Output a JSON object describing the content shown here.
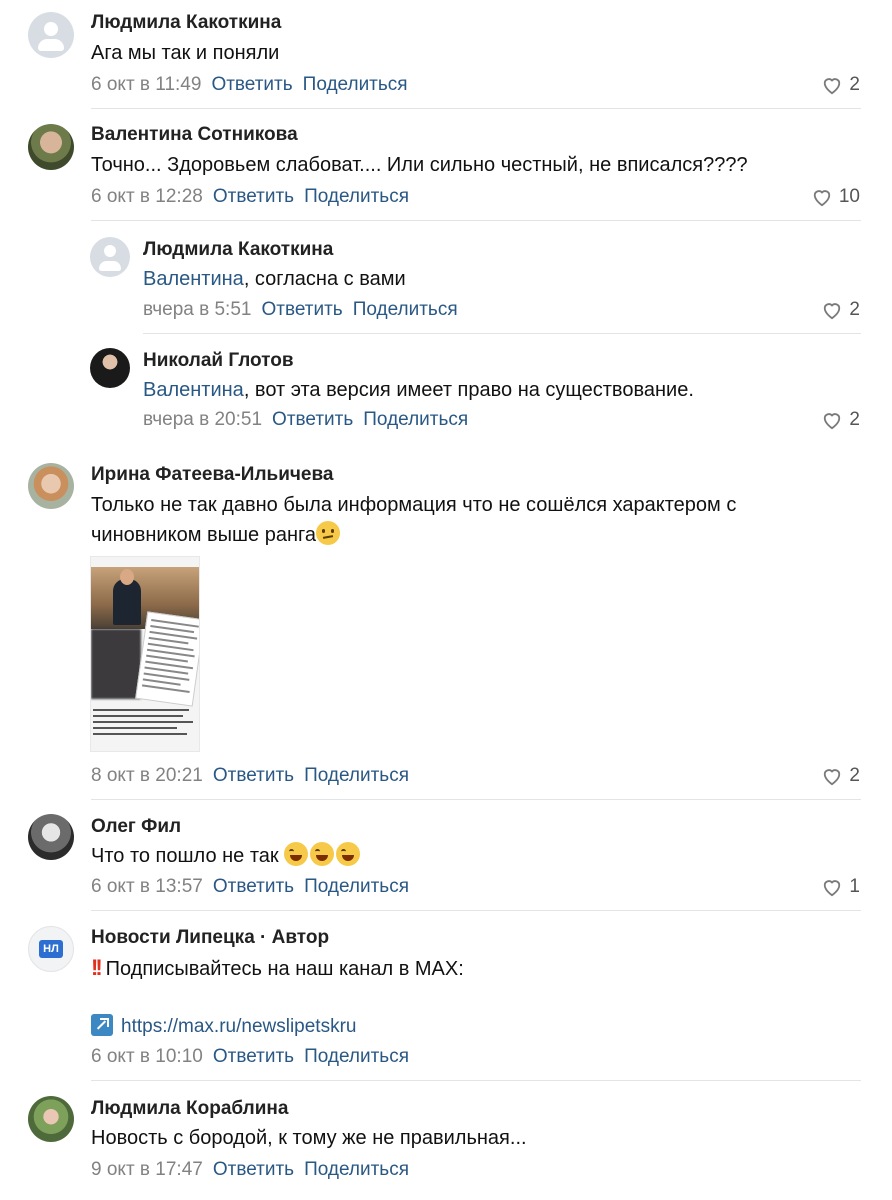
{
  "actions": {
    "reply": "Ответить",
    "share": "Поделиться"
  },
  "comments": [
    {
      "author": "Людмила Какоткина",
      "text": "Ага мы так и поняли",
      "time": "6 окт в 11:49",
      "likes": "2",
      "avatar": "placeholder-avatar"
    },
    {
      "author": "Валентина Сотникова",
      "text": "Точно... Здоровьем слабоват.... Или сильно честный, не вписался????",
      "time": "6 окт в 12:28",
      "likes": "10",
      "avatar": "user-photo"
    },
    {
      "author": "Людмила Какоткина",
      "mention": "Валентина",
      "text": ", согласна с вами",
      "time": "вчера в 5:51",
      "likes": "2",
      "avatar": "placeholder-avatar"
    },
    {
      "author": "Николай Глотов",
      "mention": "Валентина",
      "text": ", вот эта версия имеет право на существование.",
      "time": "вчера в 20:51",
      "likes": "2",
      "avatar": "user-photo"
    },
    {
      "author": "Ирина Фатеева-Ильичева",
      "text_line1": "Только не так давно была информация что не сошёлся характером с",
      "text_line2": "чиновником выше ранга",
      "emoji": "thinking-face",
      "time": "8 окт в 20:21",
      "likes": "2",
      "avatar": "user-photo"
    },
    {
      "author": "Олег Фил",
      "text": "Что то пошло не так ",
      "emoji": "face-with-tears-of-joy",
      "time": "6 окт в 13:57",
      "likes": "1",
      "avatar": "user-photo"
    },
    {
      "author": "Новости Липецка · Автор",
      "text": "Подписывайтесь на наш канал в MAX:",
      "link": "https://max.ru/newslipetskru",
      "time": "6 окт в 10:10",
      "avatar_label": "НЛ"
    },
    {
      "author": "Людмила Кораблина",
      "text": "Новость с бородой, к тому же не правильная...",
      "time": "9 окт в 17:47",
      "avatar": "user-photo"
    }
  ],
  "colors": {
    "link": "#2a5885",
    "meta": "#828282",
    "divider": "#e3e4e8",
    "brand": "#2d6fd0"
  }
}
